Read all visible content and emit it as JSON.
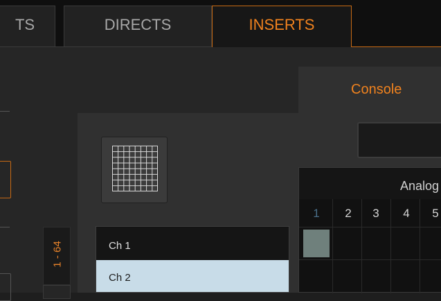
{
  "tabs": {
    "first_partial": "TS",
    "directs": "DIRECTS",
    "inserts": "INSERTS"
  },
  "console_tab": "Console",
  "range_tab": "1 - 64",
  "channels": [
    "Ch 1",
    "Ch 2"
  ],
  "selected_channel": "Ch 2",
  "matrix": {
    "title": "Analog",
    "columns": [
      "1",
      "2",
      "3",
      "4",
      "5"
    ]
  },
  "colors": {
    "accent": "#f0821e",
    "selected_row": "#c8dce8",
    "active_cell": "#6f807c"
  },
  "icons": {
    "grid_button": "grid-icon"
  }
}
